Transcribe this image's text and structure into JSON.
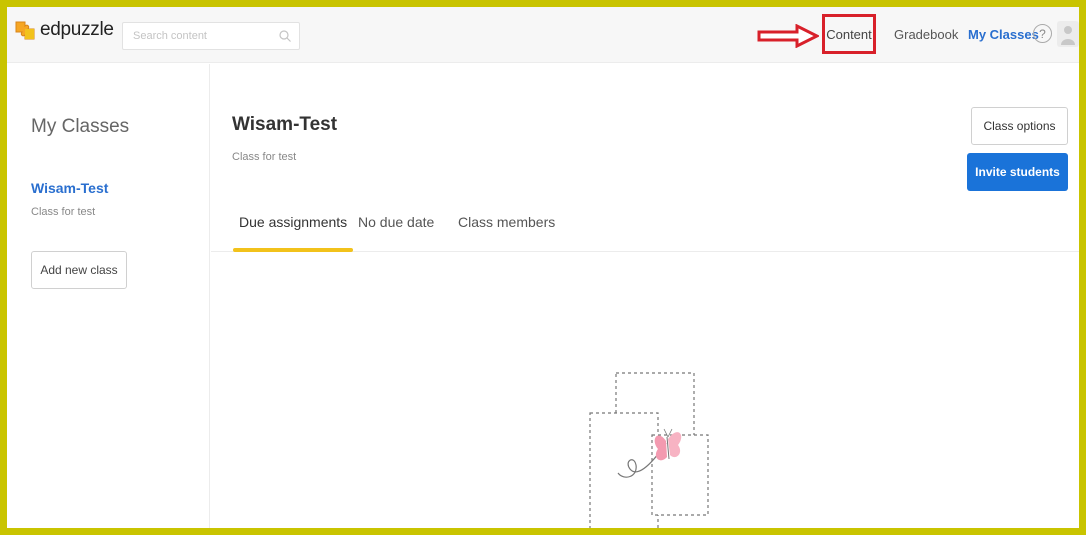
{
  "header": {
    "logo_text": "edpuzzle",
    "search_placeholder": "Search content",
    "nav": {
      "content": "Content",
      "gradebook": "Gradebook",
      "my_classes": "My Classes"
    },
    "help_symbol": "?"
  },
  "sidebar": {
    "title": "My Classes",
    "classes": [
      {
        "name": "Wisam-Test",
        "description": "Class for test"
      }
    ],
    "add_button": "Add new class"
  },
  "main": {
    "class_title": "Wisam-Test",
    "class_description": "Class for test",
    "buttons": {
      "class_options": "Class options",
      "invite_students": "Invite students"
    },
    "tabs": [
      {
        "label": "Due assignments",
        "active": true
      },
      {
        "label": "No due date",
        "active": false
      },
      {
        "label": "Class members",
        "active": false
      }
    ]
  },
  "colors": {
    "frame_border": "#c9c400",
    "accent_blue": "#1a73d9",
    "tab_underline": "#f2c21b",
    "annotation_red": "#d8202a"
  },
  "icons": [
    "puzzle-logo-icon",
    "search-icon",
    "red-arrow-annotation",
    "help-icon",
    "user-avatar-icon",
    "butterfly-illustration"
  ]
}
